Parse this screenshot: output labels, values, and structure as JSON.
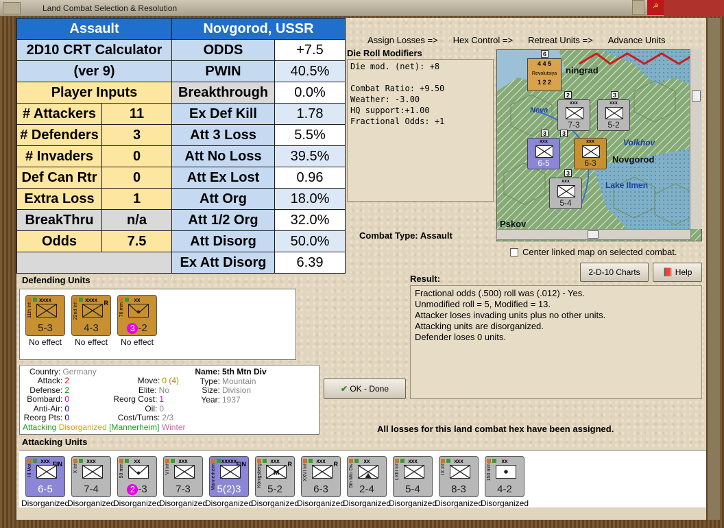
{
  "window": {
    "title": "Land Combat Selection & Resolution",
    "flag_icon": "soviet-flag-icon"
  },
  "crt": {
    "rows": [
      {
        "l1": "Assault",
        "l2": null,
        "r1": "Novgorod, USSR",
        "r2": null,
        "left_style": "blue",
        "right_style": "blue"
      },
      {
        "l1": "2D10 CRT Calculator",
        "l2": null,
        "r1": "ODDS",
        "r2": "+7.5",
        "left_style": "lblue",
        "right_style": "lblue"
      },
      {
        "l1": "(ver 9)",
        "l2": null,
        "r1": "PWIN",
        "r2": "40.5%",
        "left_style": "lblue",
        "right_style": "lblue"
      },
      {
        "l1": "Player Inputs",
        "l2": null,
        "r1": "Breakthrough",
        "r2": "0.0%",
        "left_style": "yel",
        "right_style": "gray"
      },
      {
        "l1": "# Attackers",
        "l2": "11",
        "r1": "Ex Def Kill",
        "r2": "1.78",
        "left_style": "yel",
        "right_style": "lblue"
      },
      {
        "l1": "# Defenders",
        "l2": "3",
        "r1": "Att 3 Loss",
        "r2": "5.5%",
        "left_style": "yel",
        "right_style": "lblue"
      },
      {
        "l1": "# Invaders",
        "l2": "0",
        "r1": "Att No Loss",
        "r2": "39.5%",
        "left_style": "yel",
        "right_style": "lblue"
      },
      {
        "l1": "Def Can Rtr",
        "l2": "0",
        "r1": "Att Ex Lost",
        "r2": "0.96",
        "left_style": "yel",
        "right_style": "lblue"
      },
      {
        "l1": "Extra Loss",
        "l2": "1",
        "r1": "Att Org",
        "r2": "18.0%",
        "left_style": "yel",
        "right_style": "lblue"
      },
      {
        "l1": "BreakThru",
        "l2": "n/a",
        "r1": "Att 1/2 Org",
        "r2": "32.0%",
        "left_style": "gray",
        "right_style": "lblue"
      },
      {
        "l1": "Odds",
        "l2": "7.5",
        "r1": "Att Disorg",
        "r2": "50.0%",
        "left_style": "yel",
        "right_style": "lblue"
      },
      {
        "l1": "",
        "l2": null,
        "r1": "Ex Att Disorg",
        "r2": "6.39",
        "left_style": "empty",
        "right_style": "lblue"
      }
    ]
  },
  "phases": [
    "Assign Losses =>",
    "Hex Control =>",
    "Retreat Units =>",
    "Advance Units"
  ],
  "drm": {
    "title": "Die Roll Modifiers",
    "lines": [
      "Die mod. (net): +8",
      "",
      "Combat Ratio: +9.50",
      "Weather: -3.00",
      "HQ support:+1.00",
      "Fractional Odds: +1"
    ]
  },
  "combat_type": "Combat Type:  Assault",
  "map": {
    "labels": {
      "leningrad": "ningrad",
      "neva": "Neva",
      "volkhov": "Volkhov",
      "novgorod": "Novgorod",
      "ilmen": "Lake Ilmen",
      "pskov": "Pskov"
    },
    "stack_counts": [
      "6",
      "2",
      "3",
      "3",
      "3",
      "3"
    ],
    "counters": [
      {
        "size": "xxx",
        "str": "7-3"
      },
      {
        "size": "xxx",
        "str": "5-2"
      },
      {
        "size": "xxx",
        "str": "6-5"
      },
      {
        "size": "xxx",
        "str": "6-3"
      },
      {
        "size": "xxx",
        "str": "5-4"
      }
    ],
    "leningrad_counter": {
      "top": "4  4  5",
      "mid": "Revolutsiya",
      "bot": "1  2  2"
    }
  },
  "center_checkbox": "Center linked map on selected combat.",
  "buttons": {
    "charts": "2-D-10 Charts",
    "help": "Help",
    "ok": "OK - Done"
  },
  "result": {
    "title": "Result:",
    "lines": [
      "Fractional odds (.500) roll was (.012)  - Yes.",
      "Unmodified roll = 5, Modified = 13.",
      "Attacker loses invading units plus no other units.",
      "Attacking units are disorganized.",
      "Defender loses 0 units."
    ]
  },
  "losses_message": "All losses for this land combat hex have been assigned.",
  "defending": {
    "title": "Defending Units",
    "units": [
      {
        "size": "xxxx",
        "id": "11th Inf",
        "str": "5-3",
        "status": "No effect",
        "type": "inf",
        "r": ""
      },
      {
        "size": "xxxx",
        "id": "22nd Inf",
        "str": "4-3",
        "status": "No effect",
        "type": "inf",
        "r": "R"
      },
      {
        "size": "xx",
        "id": "76 mm",
        "str_a": "3",
        "str_b": "-2",
        "status": "No effect",
        "type": "art",
        "r": ""
      }
    ]
  },
  "info": {
    "country_k": "Country:",
    "country_v": "Germany",
    "attack_k": "Attack:",
    "attack_v": "2",
    "defense_k": "Defense:",
    "defense_v": "2",
    "bombard_k": "Bombard:",
    "bombard_v": "0",
    "antiair_k": "Anti-Air:",
    "antiair_v": "0",
    "reorgpts_k": "Reorg Pts:",
    "reorgpts_v": "0",
    "move_k": "Move:",
    "move_v": "0 (4)",
    "elite_k": "Elite:",
    "elite_v": "No",
    "reorgcost_k": "Reorg Cost:",
    "reorgcost_v": "1",
    "oil_k": "Oil:",
    "oil_v": "0",
    "cost_k": "Cost/Turns:",
    "cost_v": "2/3",
    "name_k": "Name:",
    "name_v": "5th Mtn Div",
    "type_k": "Type:",
    "type_v": "Mountain",
    "size_k": "Size:",
    "size_v": "Division",
    "year_k": "Year:",
    "year_v": "1937",
    "tag_attacking": "Attacking",
    "tag_disorg": "Disorganized",
    "tag_mann": "[Mannerheim]",
    "tag_winter": "Winter"
  },
  "attacking": {
    "title": "Attacking Units",
    "units": [
      {
        "size": "xxx",
        "id": "III Mot",
        "str": "6-5",
        "status": "Disorganized",
        "color": "blue",
        "type": "inf",
        "r": "FIN"
      },
      {
        "size": "xxx",
        "id": "X Inf",
        "str": "7-4",
        "status": "Disorganized",
        "color": "gray",
        "type": "inf",
        "r": ""
      },
      {
        "size": "xx",
        "id": "50 mm",
        "str_a": "2",
        "str_b": "-3",
        "status": "Disorganized",
        "color": "gray",
        "type": "art",
        "r": ""
      },
      {
        "size": "xxx",
        "id": "VI Inf",
        "str": "7-3",
        "status": "Disorganized",
        "color": "gray",
        "type": "inf",
        "r": ""
      },
      {
        "size": "xxxxx",
        "id": "Mannerheim",
        "str": "5(2)3",
        "status": "Disorganized",
        "color": "blue",
        "type": "inf",
        "r": "FIN"
      },
      {
        "size": "xxx",
        "id": "Königsberg",
        "str": "5-2",
        "status": "Disorganized",
        "color": "gray",
        "type": "m",
        "r": "R"
      },
      {
        "size": "xxx",
        "id": "XXVI Inf",
        "str": "6-3",
        "status": "Disorganized",
        "color": "gray",
        "type": "inf",
        "r": "R"
      },
      {
        "size": "xx",
        "id": "5th Mtn Div",
        "str": "2-4",
        "status": "Disorganized",
        "color": "gray",
        "type": "mtn",
        "r": ""
      },
      {
        "size": "xxx",
        "id": "LXIII Inf",
        "str": "5-4",
        "status": "Disorganized",
        "color": "gray",
        "type": "inf",
        "r": ""
      },
      {
        "size": "xxx",
        "id": "IX Inf",
        "str": "8-3",
        "status": "Disorganized",
        "color": "gray",
        "type": "inf",
        "r": ""
      },
      {
        "size": "xx",
        "id": "150 mm",
        "str": "4-2",
        "status": "Disorganized",
        "color": "gray",
        "type": "dot",
        "r": ""
      }
    ]
  },
  "colors": {
    "attack": "#d40000",
    "defense": "#009900",
    "bombard": "#cc00cc",
    "antiair": "#0000cc",
    "disorg": "#e0a000",
    "mann": "#20a020",
    "winter": "#cc66aa"
  }
}
